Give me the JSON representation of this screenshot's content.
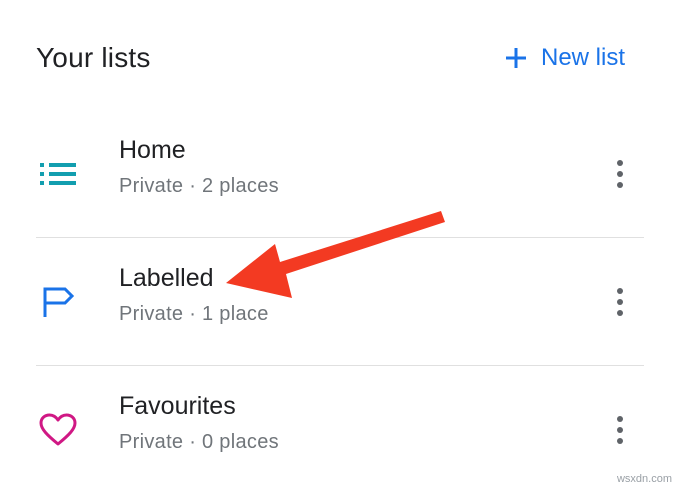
{
  "header": {
    "title": "Your lists",
    "new_list_label": "New list"
  },
  "lists": [
    {
      "name": "Home",
      "meta": "Private · 2 places",
      "icon": "list-icon",
      "color": "#129eaf"
    },
    {
      "name": "Labelled",
      "meta": "Private · 1 place",
      "icon": "flag-icon",
      "color": "#1a73e8"
    },
    {
      "name": "Favourites",
      "meta": "Private · 0 places",
      "icon": "heart-icon",
      "color": "#d01884"
    }
  ],
  "annotation": {
    "arrow_color": "#f33a22"
  },
  "watermark": "wsxdn.com"
}
